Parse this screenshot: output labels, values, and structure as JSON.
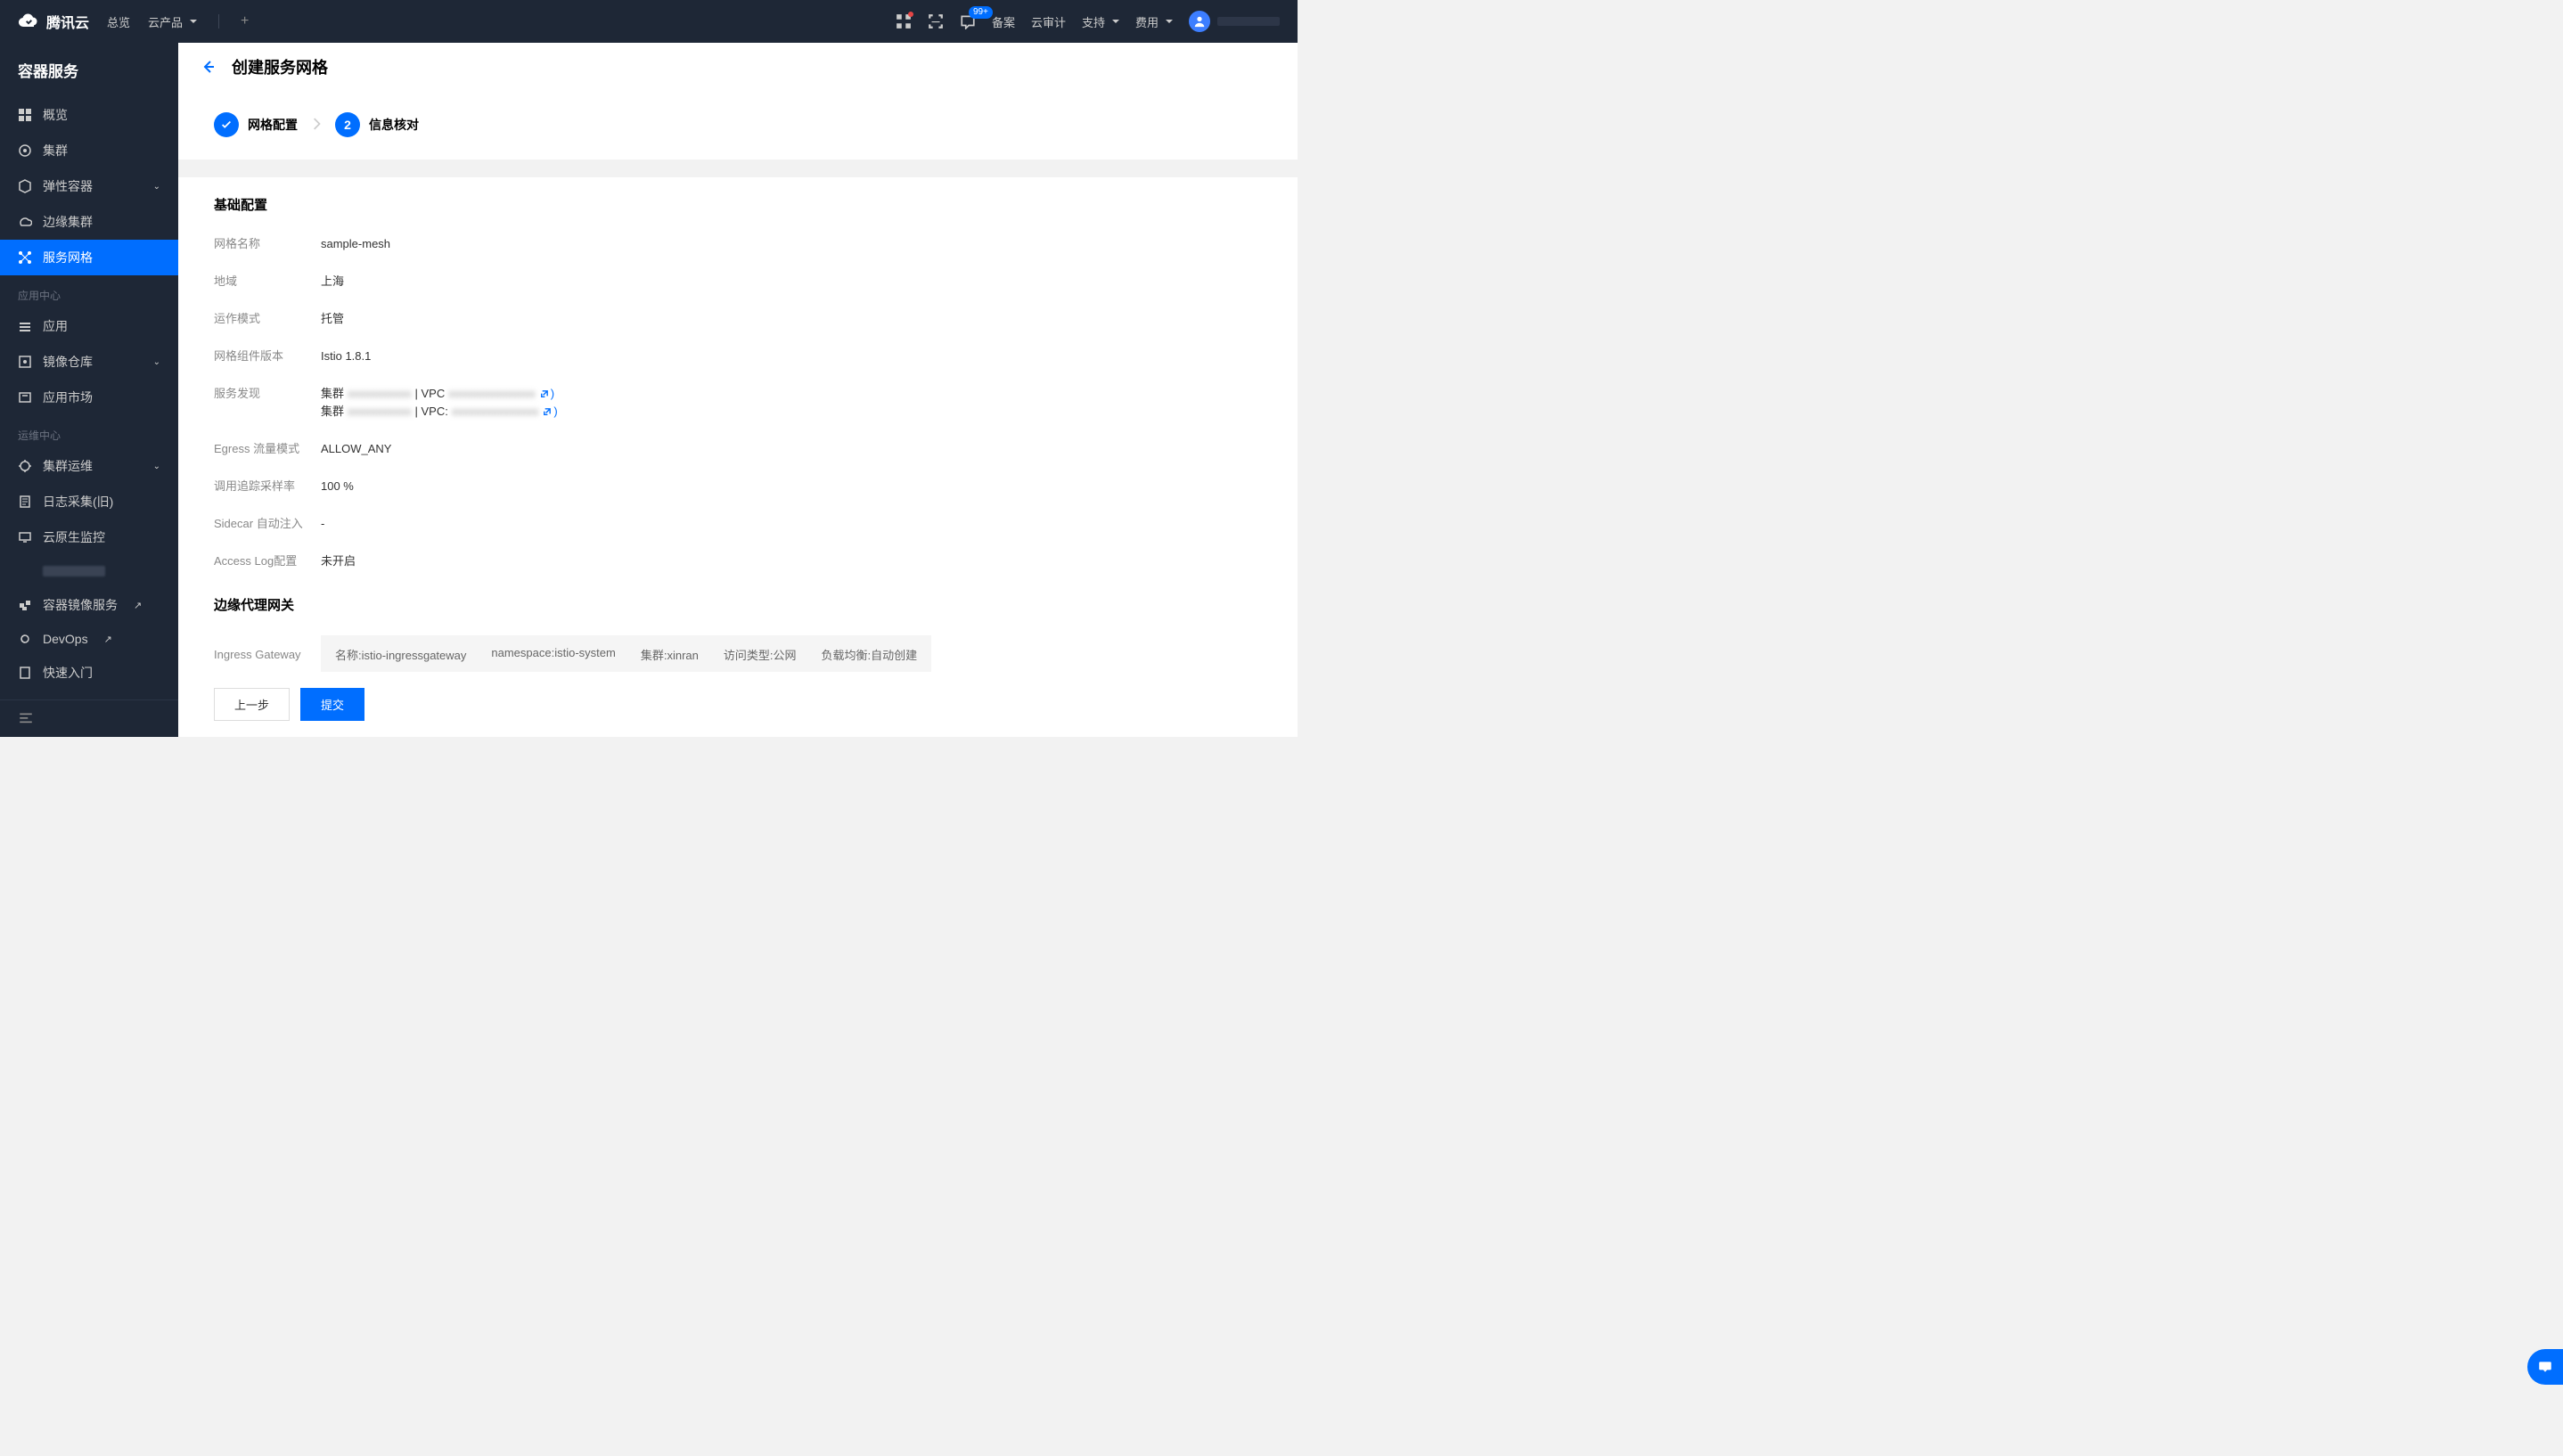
{
  "brand": "腾讯云",
  "topnav": {
    "left": [
      "总览",
      "云产品"
    ],
    "right": [
      "备案",
      "云审计",
      "支持",
      "费用"
    ],
    "badge": "99+"
  },
  "sidebar": {
    "title": "容器服务",
    "items": {
      "overview": "概览",
      "cluster": "集群",
      "elastic": "弹性容器",
      "edge": "边缘集群",
      "mesh": "服务网格"
    },
    "group_app": "应用中心",
    "app_items": {
      "app": "应用",
      "image_repo": "镜像仓库",
      "market": "应用市场"
    },
    "group_ops": "运维中心",
    "ops_items": {
      "cluster_ops": "集群运维",
      "log": "日志采集(旧)",
      "monitor": "云原生监控",
      "tcr": "容器镜像服务",
      "devops": "DevOps",
      "quickstart": "快速入门"
    }
  },
  "page": {
    "title": "创建服务网格",
    "step1": "网格配置",
    "step2_num": "2",
    "step2": "信息核对"
  },
  "basic": {
    "section": "基础配置",
    "name_label": "网格名称",
    "name_value": "sample-mesh",
    "region_label": "地域",
    "region_value": "上海",
    "mode_label": "运作模式",
    "mode_value": "托管",
    "version_label": "网格组件版本",
    "version_value": "Istio 1.8.1",
    "discovery_label": "服务发现",
    "discovery_line1a": "集群",
    "discovery_line1b": "| VPC",
    "discovery_line2a": "集群",
    "discovery_line2b": "| VPC:",
    "egress_label": "Egress 流量模式",
    "egress_value": "ALLOW_ANY",
    "trace_label": "调用追踪采样率",
    "trace_value": "100 %",
    "sidecar_label": "Sidecar 自动注入",
    "sidecar_value": "-",
    "alog_label": "Access Log配置",
    "alog_value": "未开启"
  },
  "gateway": {
    "section": "边缘代理网关",
    "label": "Ingress Gateway",
    "name": "名称:istio-ingressgateway",
    "ns": "namespace:istio-system",
    "cluster": "集群:xinran",
    "access": "访问类型:公网",
    "lb": "负载均衡:自动创建"
  },
  "footer": {
    "prev": "上一步",
    "submit": "提交"
  }
}
